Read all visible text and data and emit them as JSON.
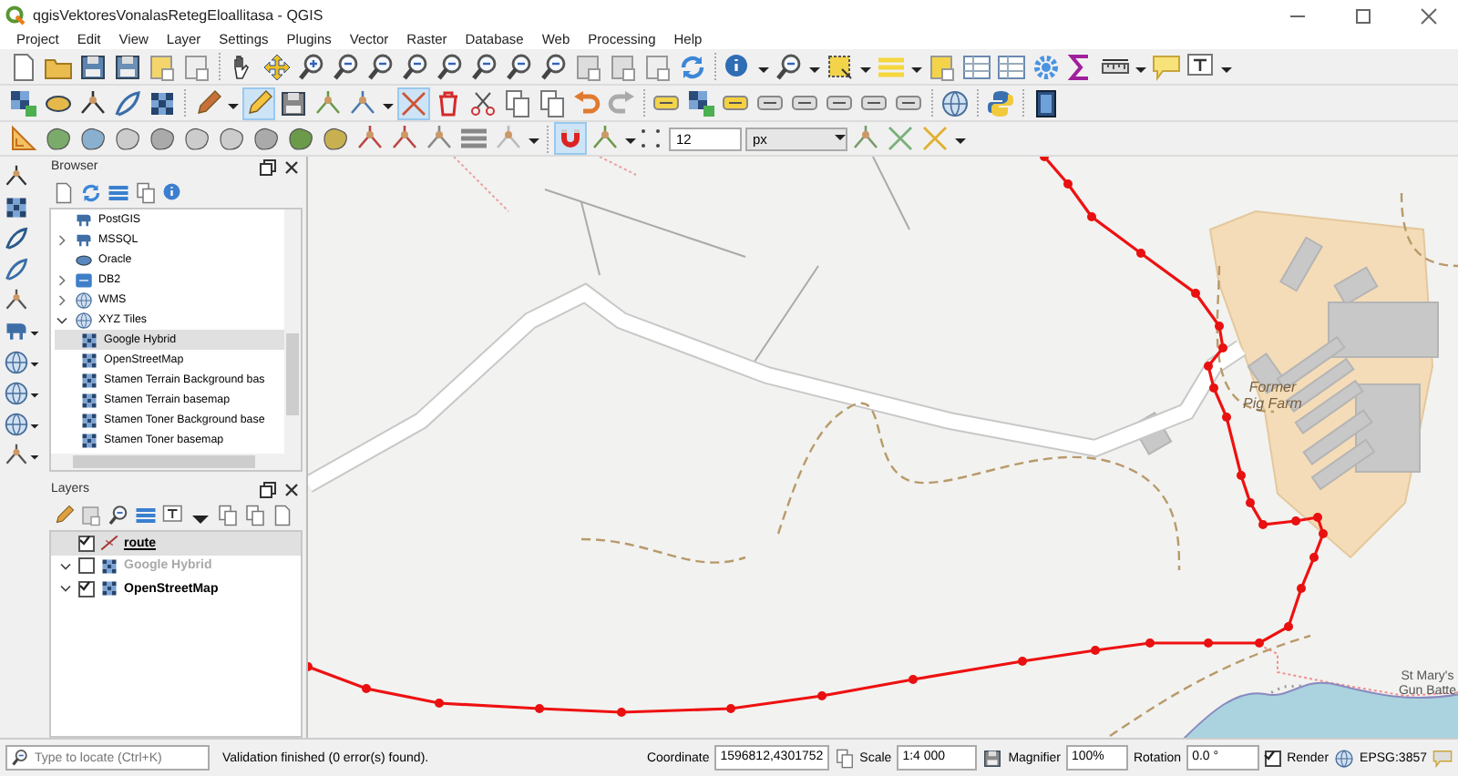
{
  "window": {
    "title": "qgisVektoresVonalasRetegEloallitasa - QGIS"
  },
  "menu": [
    "Project",
    "Edit",
    "View",
    "Layer",
    "Settings",
    "Plugins",
    "Vector",
    "Raster",
    "Database",
    "Web",
    "Processing",
    "Help"
  ],
  "snapping": {
    "tolerance": "12",
    "unit": "px"
  },
  "browser": {
    "title": "Browser",
    "items": [
      {
        "label": "PostGIS"
      },
      {
        "label": "MSSQL",
        "expanded": false
      },
      {
        "label": "Oracle"
      },
      {
        "label": "DB2",
        "expanded": false
      },
      {
        "label": "WMS",
        "expanded": false
      },
      {
        "label": "XYZ Tiles",
        "expanded": true,
        "children": [
          {
            "label": "Google Hybrid",
            "selected": true
          },
          {
            "label": "OpenStreetMap",
            "selected": false
          },
          {
            "label": "Stamen Terrain Background bas",
            "selected": false
          },
          {
            "label": "Stamen Terrain basemap",
            "selected": false
          },
          {
            "label": "Stamen Toner Background base",
            "selected": false
          },
          {
            "label": "Stamen Toner basemap",
            "selected": false
          }
        ]
      }
    ]
  },
  "layers": {
    "title": "Layers",
    "items": [
      {
        "label": "route",
        "kind": "vector",
        "checked": true,
        "selected": true
      },
      {
        "label": "Google Hybrid",
        "kind": "raster",
        "expanded": true,
        "checked": false,
        "selected": false
      },
      {
        "label": "OpenStreetMap",
        "kind": "raster",
        "expanded": true,
        "checked": true,
        "selected": false
      }
    ]
  },
  "map": {
    "labels": [
      {
        "text": "Former Pig Farm",
        "kind": "area"
      },
      {
        "text": "St Mary's Gun Batte",
        "kind": "poi"
      }
    ]
  },
  "status_bar": {
    "locator_placeholder": "Type to locate (Ctrl+K)",
    "message": "Validation finished (0 error(s) found).",
    "coordinate_label": "Coordinate",
    "coordinate": "1596812,4301752",
    "scale_label": "Scale",
    "scale": "1:4 000",
    "magnifier_label": "Magnifier",
    "magnifier": "100%",
    "rotation_label": "Rotation",
    "rotation": "0.0 °",
    "render_label": "Render",
    "render": true,
    "crs": "EPSG:3857"
  }
}
